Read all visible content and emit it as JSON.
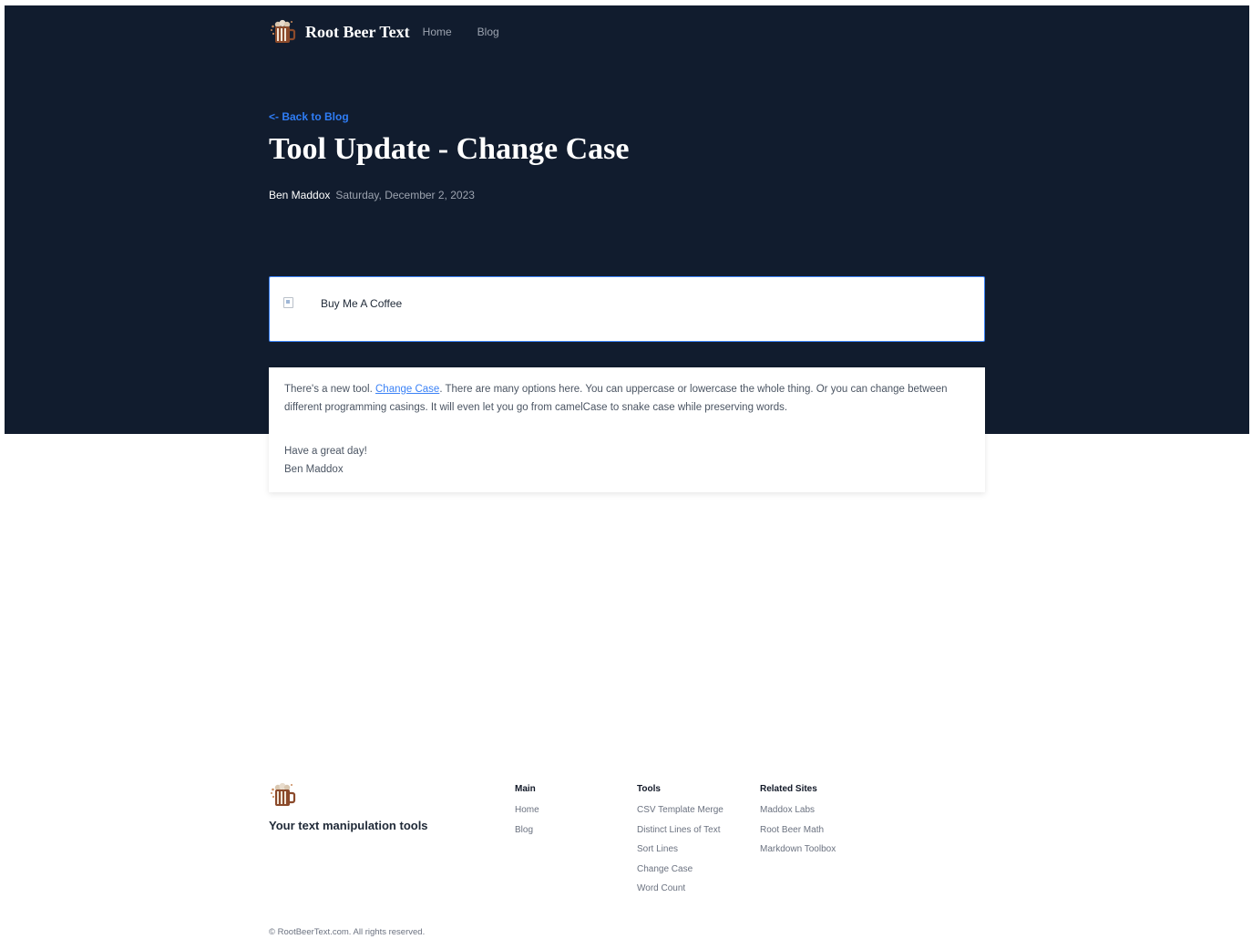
{
  "header": {
    "brand": "Root Beer Text",
    "logo_icon": "root-beer-mug-icon",
    "nav": [
      "Home",
      "Blog"
    ]
  },
  "post": {
    "back_link": "<- Back to Blog",
    "title": "Tool Update - Change Case",
    "author": "Ben Maddox",
    "date": "Saturday, December 2, 2023",
    "coffee_alt": "Buy Me A Coffee",
    "body": {
      "p1_before": "There's a new tool. ",
      "p1_link": "Change Case",
      "p1_after": ". There are many options here. You can uppercase or lowercase the whole thing. Or you can change between different programming casings. It will even let you go from camelCase to snake case while preserving words.",
      "signoff": "Have a great day!",
      "signature": "Ben Maddox"
    }
  },
  "footer": {
    "tagline": "Your text manipulation tools",
    "columns": [
      {
        "heading": "Main",
        "links": [
          "Home",
          "Blog"
        ]
      },
      {
        "heading": "Tools",
        "links": [
          "CSV Template Merge",
          "Distinct Lines of Text",
          "Sort Lines",
          "Change Case",
          "Word Count"
        ]
      },
      {
        "heading": "Related Sites",
        "links": [
          "Maddox Labs",
          "Root Beer Math",
          "Markdown Toolbox"
        ]
      }
    ],
    "copyright": "© RootBeerText.com. All rights reserved."
  },
  "colors": {
    "hero_bg": "#111c2e",
    "accent": "#3b82f6",
    "back_link": "#2f7df6"
  }
}
